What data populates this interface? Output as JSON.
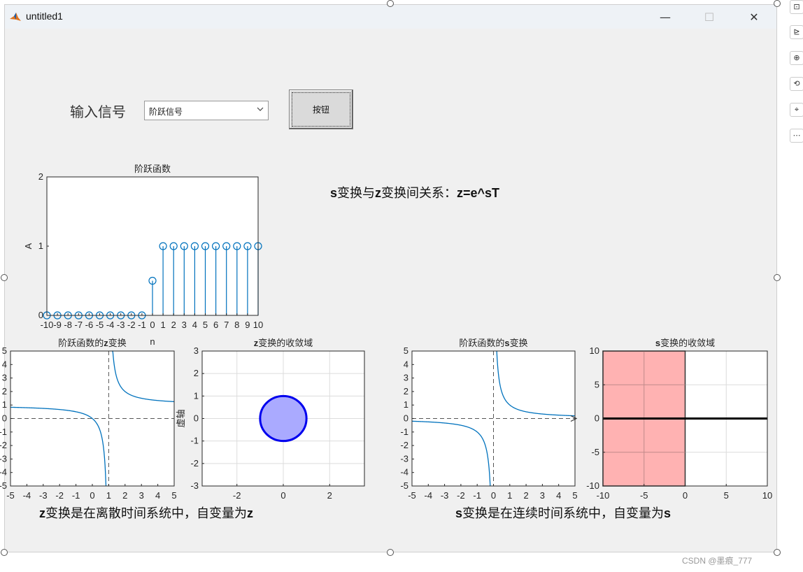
{
  "window": {
    "title": "untitled1",
    "minimize_glyph": "—",
    "maximize_glyph": "☐",
    "close_glyph": "✕",
    "icon": "matlab-icon"
  },
  "controls": {
    "input_label": "输入信号",
    "signal_select": {
      "value": "阶跃信号",
      "options": [
        "阶跃信号"
      ]
    },
    "button_label": "按钮"
  },
  "texts": {
    "relation_prefix_bold": "s",
    "relation_mid": "变换与",
    "relation_z_bold": "z",
    "relation_suffix": "变换间关系：",
    "relation_formula": "z=e^sT",
    "z_caption_bold": "z",
    "z_caption_mid": "变换是在离散时间系统中，自变量为",
    "z_caption_end": "z",
    "s_caption_bold": "s",
    "s_caption_mid": "变换是在连续时间系统中，自变量为",
    "s_caption_end": "s"
  },
  "side_toolbar": [
    "export-icon",
    "brush-icon",
    "zoom-in-icon",
    "rotate-icon",
    "pan-icon",
    "more-icon"
  ],
  "side_toolbar_glyphs": [
    "⊡",
    "⊵",
    "⊕",
    "⟲",
    "⌖",
    "⋯"
  ],
  "watermark": "CSDN @墨痕_777",
  "colors": {
    "series": "#0072BD",
    "roc_fill": "#aaaaff",
    "roc_edge": "#0000ee",
    "s_roc_fill": "#ffaaaa"
  },
  "chart_data": [
    {
      "type": "stem",
      "title": "阶跃函数",
      "xlabel": "n",
      "ylabel": "A",
      "xlim": [
        -10,
        10
      ],
      "ylim": [
        0,
        2
      ],
      "xticks": [
        -10,
        -9,
        -8,
        -7,
        -6,
        -5,
        -4,
        -3,
        -2,
        -1,
        0,
        1,
        2,
        3,
        4,
        5,
        6,
        7,
        8,
        9,
        10
      ],
      "yticks": [
        0,
        1,
        2
      ],
      "x": [
        -10,
        -9,
        -8,
        -7,
        -6,
        -5,
        -4,
        -3,
        -2,
        -1,
        0,
        1,
        2,
        3,
        4,
        5,
        6,
        7,
        8,
        9,
        10
      ],
      "y": [
        0,
        0,
        0,
        0,
        0,
        0,
        0,
        0,
        0,
        0,
        0.5,
        1,
        1,
        1,
        1,
        1,
        1,
        1,
        1,
        1,
        1
      ]
    },
    {
      "type": "line",
      "title_prefix": "阶跃函数的",
      "title_bold": "z",
      "title_suffix": "变换",
      "function": "z/(z-1)",
      "xlim": [
        -5,
        5
      ],
      "ylim": [
        -5,
        5
      ],
      "xticks": [
        -5,
        -4,
        -3,
        -2,
        -1,
        0,
        1,
        2,
        3,
        4,
        5
      ],
      "yticks": [
        -5,
        -4,
        -3,
        -2,
        -1,
        0,
        1,
        2,
        3,
        4,
        5
      ],
      "asymptote_x": 1,
      "asymptote_y": 1,
      "baseline_y": 0
    },
    {
      "type": "region",
      "title_bold": "z",
      "title_suffix": "变换的收敛域",
      "ylabel": "虚轴",
      "xlim": [
        -3.5,
        3.5
      ],
      "ylim": [
        -3,
        3
      ],
      "xticks": [
        -2,
        0,
        2
      ],
      "yticks": [
        -3,
        -2,
        -1,
        0,
        1,
        2,
        3
      ],
      "circle": {
        "center": [
          0,
          0
        ],
        "radius": 1
      },
      "grid": true
    },
    {
      "type": "line",
      "title_prefix": "阶跃函数的",
      "title_bold": "s",
      "title_suffix": "变换",
      "function": "1/s",
      "xlim": [
        -5,
        5
      ],
      "ylim": [
        -5,
        5
      ],
      "xticks": [
        -5,
        -4,
        -3,
        -2,
        -1,
        0,
        1,
        2,
        3,
        4,
        5
      ],
      "yticks": [
        -5,
        -4,
        -3,
        -2,
        -1,
        0,
        1,
        2,
        3,
        4,
        5
      ],
      "asymptote_x": 0,
      "baseline_y": 0
    },
    {
      "type": "region",
      "title_bold": "s",
      "title_suffix": "变换的收敛域",
      "xlim": [
        -10,
        10
      ],
      "ylim": [
        -10,
        10
      ],
      "xticks": [
        -10,
        -5,
        0,
        5,
        10
      ],
      "yticks": [
        -10,
        -5,
        0,
        5,
        10
      ],
      "shaded_x_range": [
        -10,
        0
      ],
      "real_axis_line_y": 0,
      "grid": true
    }
  ]
}
